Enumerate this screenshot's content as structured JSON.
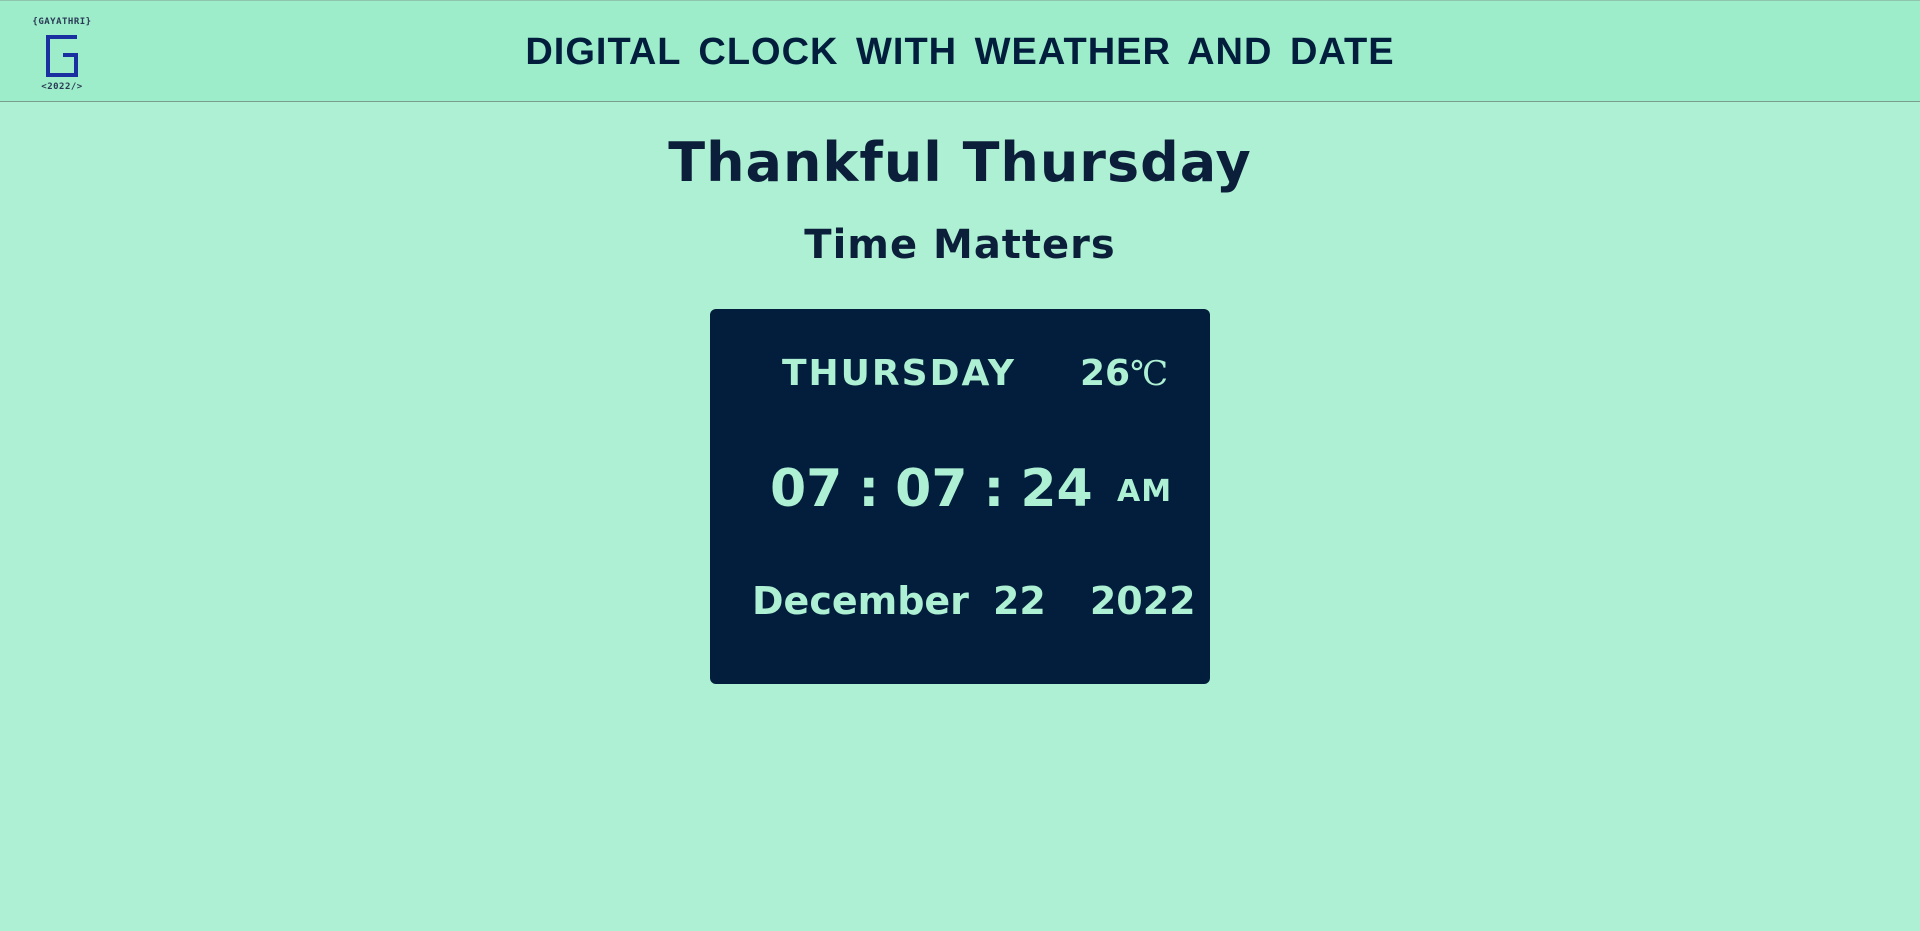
{
  "header": {
    "logo": {
      "top_text": "{GAYATHRI}",
      "letter": "G",
      "bottom_text": "<2022/>",
      "icon": "g-logo-icon"
    },
    "title": "DIGITAL CLOCK WITH WEATHER AND DATE"
  },
  "main": {
    "greeting": "Thankful Thursday",
    "tagline": "Time Matters"
  },
  "clock": {
    "day": "THURSDAY",
    "temperature": "26",
    "temperature_unit": "℃",
    "hours": "07",
    "minutes": "07",
    "seconds": "24",
    "separator": ":",
    "period": "AM",
    "month": "December",
    "date": "22",
    "year": "2022"
  },
  "colors": {
    "background": "#aef0d3",
    "header_background": "#9decca",
    "card_background": "#021e3c",
    "card_text": "#aef0d3",
    "logo_blue": "#1a2fa0"
  }
}
